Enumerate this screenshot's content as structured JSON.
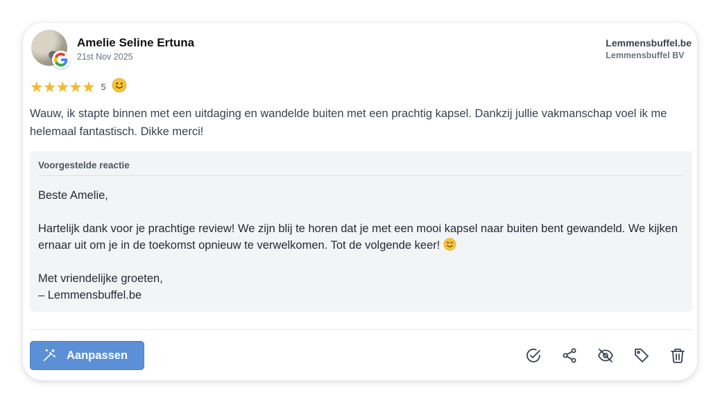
{
  "review": {
    "author": "Amelie Seline Ertuna",
    "date": "21st Nov 2025",
    "source_icon": "google-icon",
    "rating": "5",
    "rating_stars": "★★★★★",
    "text": "Wauw, ik stapte binnen met een uitdaging en wandelde buiten met een prachtig kapsel. Dankzij jullie vakmanschap voel ik me helemaal fantastisch. Dikke merci!"
  },
  "business": {
    "name": "Lemmensbuffel.be",
    "company": "Lemmensbuffel BV"
  },
  "suggestion": {
    "title": "Voorgestelde reactie",
    "greeting": "Beste Amelie,",
    "body": "Hartelijk dank voor je prachtige review! We zijn blij te horen dat je met een mooi kapsel naar buiten bent gewandeld. We kijken ernaar uit om je in de toekomst opnieuw te verwelkomen. Tot de volgende keer! ",
    "closing": "Met vriendelijke groeten,",
    "signature": "– Lemmensbuffel.be"
  },
  "toolbar": {
    "adjust_label": "Aanpassen",
    "actions": [
      "approve-icon",
      "share-icon",
      "hide-icon",
      "tag-icon",
      "delete-icon"
    ]
  },
  "colors": {
    "primary_button": "#5b8fd6",
    "star": "#f5b82e",
    "suggestion_bg": "#f3f4f6"
  }
}
